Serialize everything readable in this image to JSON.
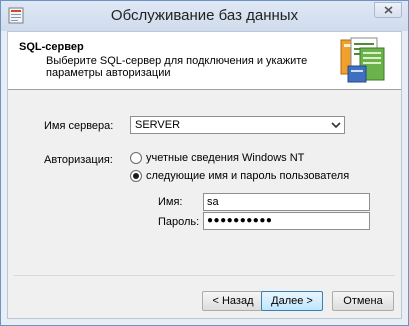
{
  "window": {
    "title": "Обслуживание баз данных"
  },
  "header": {
    "title": "SQL-сервер",
    "description": "Выберите SQL-сервер для подключения и укажите параметры авторизации"
  },
  "server": {
    "label": "Имя сервера:",
    "value": "SERVER"
  },
  "auth": {
    "label": "Авторизация:",
    "options": [
      "учетные сведения Windows NT",
      "следующие имя и пароль пользователя"
    ],
    "selected_index": 1
  },
  "credentials": {
    "user_label": "Имя:",
    "user_value": "sa",
    "password_label": "Пароль:",
    "password_mask": "●●●●●●●●●●"
  },
  "buttons": {
    "back": "< Назад",
    "next": "Далее >",
    "cancel": "Отмена"
  }
}
